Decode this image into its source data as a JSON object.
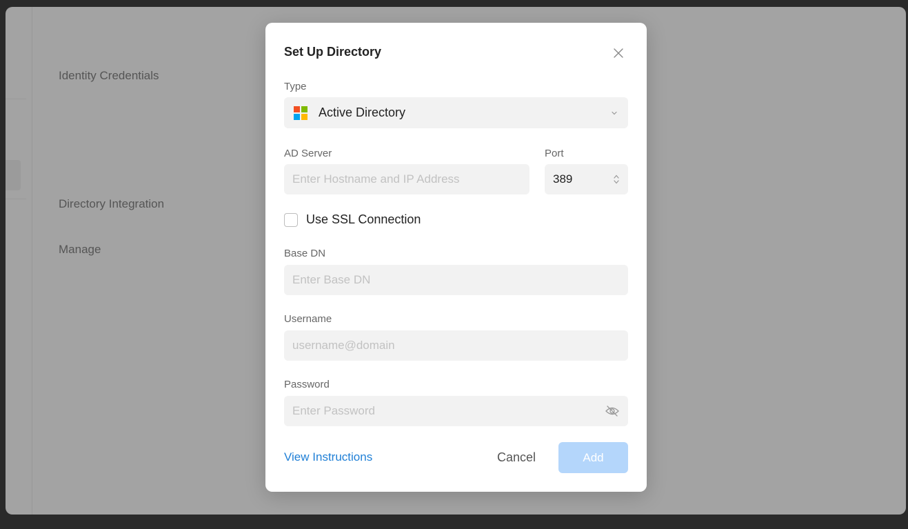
{
  "background": {
    "labels": [
      "Identity Credentials",
      "Directory Integration",
      "Manage"
    ]
  },
  "modal": {
    "title": "Set Up Directory",
    "type_label": "Type",
    "type_value": "Active Directory",
    "ad_server_label": "AD Server",
    "ad_server_placeholder": "Enter Hostname and IP Address",
    "port_label": "Port",
    "port_value": "389",
    "ssl_label": "Use SSL Connection",
    "ssl_checked": false,
    "base_dn_label": "Base DN",
    "base_dn_placeholder": "Enter Base DN",
    "username_label": "Username",
    "username_placeholder": "username@domain",
    "password_label": "Password",
    "password_placeholder": "Enter Password",
    "view_instructions": "View Instructions",
    "cancel": "Cancel",
    "add": "Add"
  },
  "icons": {
    "close": "close-icon",
    "type_logo": "microsoft-logo-icon",
    "chevron": "chevron-down-icon",
    "stepper": "stepper-icon",
    "eye": "eye-slash-icon"
  },
  "colors": {
    "accent": "#1f7fd6",
    "add_button_disabled": "#b4d6fb",
    "ms_red": "#f25022",
    "ms_green": "#7fba00",
    "ms_blue": "#00a4ef",
    "ms_yellow": "#ffb900"
  }
}
